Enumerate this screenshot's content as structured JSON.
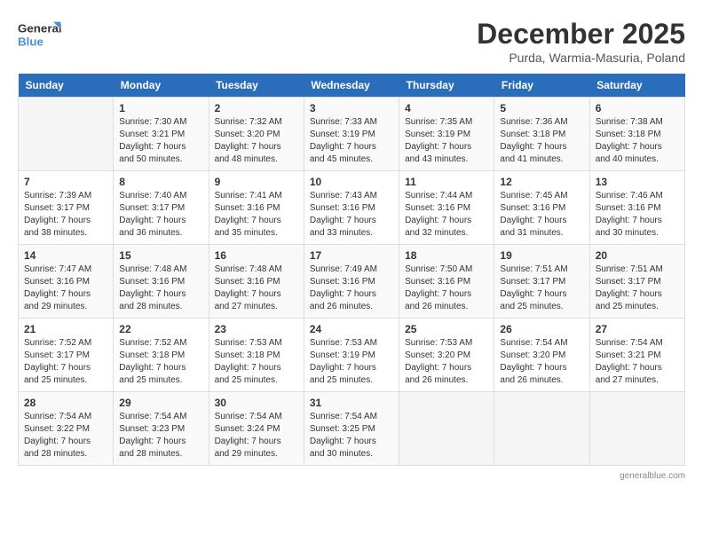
{
  "header": {
    "logo_line1": "General",
    "logo_line2": "Blue",
    "month_title": "December 2025",
    "subtitle": "Purda, Warmia-Masuria, Poland"
  },
  "weekdays": [
    "Sunday",
    "Monday",
    "Tuesday",
    "Wednesday",
    "Thursday",
    "Friday",
    "Saturday"
  ],
  "weeks": [
    [
      {
        "day": "",
        "info": ""
      },
      {
        "day": "1",
        "info": "Sunrise: 7:30 AM\nSunset: 3:21 PM\nDaylight: 7 hours\nand 50 minutes."
      },
      {
        "day": "2",
        "info": "Sunrise: 7:32 AM\nSunset: 3:20 PM\nDaylight: 7 hours\nand 48 minutes."
      },
      {
        "day": "3",
        "info": "Sunrise: 7:33 AM\nSunset: 3:19 PM\nDaylight: 7 hours\nand 45 minutes."
      },
      {
        "day": "4",
        "info": "Sunrise: 7:35 AM\nSunset: 3:19 PM\nDaylight: 7 hours\nand 43 minutes."
      },
      {
        "day": "5",
        "info": "Sunrise: 7:36 AM\nSunset: 3:18 PM\nDaylight: 7 hours\nand 41 minutes."
      },
      {
        "day": "6",
        "info": "Sunrise: 7:38 AM\nSunset: 3:18 PM\nDaylight: 7 hours\nand 40 minutes."
      }
    ],
    [
      {
        "day": "7",
        "info": "Sunrise: 7:39 AM\nSunset: 3:17 PM\nDaylight: 7 hours\nand 38 minutes."
      },
      {
        "day": "8",
        "info": "Sunrise: 7:40 AM\nSunset: 3:17 PM\nDaylight: 7 hours\nand 36 minutes."
      },
      {
        "day": "9",
        "info": "Sunrise: 7:41 AM\nSunset: 3:16 PM\nDaylight: 7 hours\nand 35 minutes."
      },
      {
        "day": "10",
        "info": "Sunrise: 7:43 AM\nSunset: 3:16 PM\nDaylight: 7 hours\nand 33 minutes."
      },
      {
        "day": "11",
        "info": "Sunrise: 7:44 AM\nSunset: 3:16 PM\nDaylight: 7 hours\nand 32 minutes."
      },
      {
        "day": "12",
        "info": "Sunrise: 7:45 AM\nSunset: 3:16 PM\nDaylight: 7 hours\nand 31 minutes."
      },
      {
        "day": "13",
        "info": "Sunrise: 7:46 AM\nSunset: 3:16 PM\nDaylight: 7 hours\nand 30 minutes."
      }
    ],
    [
      {
        "day": "14",
        "info": "Sunrise: 7:47 AM\nSunset: 3:16 PM\nDaylight: 7 hours\nand 29 minutes."
      },
      {
        "day": "15",
        "info": "Sunrise: 7:48 AM\nSunset: 3:16 PM\nDaylight: 7 hours\nand 28 minutes."
      },
      {
        "day": "16",
        "info": "Sunrise: 7:48 AM\nSunset: 3:16 PM\nDaylight: 7 hours\nand 27 minutes."
      },
      {
        "day": "17",
        "info": "Sunrise: 7:49 AM\nSunset: 3:16 PM\nDaylight: 7 hours\nand 26 minutes."
      },
      {
        "day": "18",
        "info": "Sunrise: 7:50 AM\nSunset: 3:16 PM\nDaylight: 7 hours\nand 26 minutes."
      },
      {
        "day": "19",
        "info": "Sunrise: 7:51 AM\nSunset: 3:17 PM\nDaylight: 7 hours\nand 25 minutes."
      },
      {
        "day": "20",
        "info": "Sunrise: 7:51 AM\nSunset: 3:17 PM\nDaylight: 7 hours\nand 25 minutes."
      }
    ],
    [
      {
        "day": "21",
        "info": "Sunrise: 7:52 AM\nSunset: 3:17 PM\nDaylight: 7 hours\nand 25 minutes."
      },
      {
        "day": "22",
        "info": "Sunrise: 7:52 AM\nSunset: 3:18 PM\nDaylight: 7 hours\nand 25 minutes."
      },
      {
        "day": "23",
        "info": "Sunrise: 7:53 AM\nSunset: 3:18 PM\nDaylight: 7 hours\nand 25 minutes."
      },
      {
        "day": "24",
        "info": "Sunrise: 7:53 AM\nSunset: 3:19 PM\nDaylight: 7 hours\nand 25 minutes."
      },
      {
        "day": "25",
        "info": "Sunrise: 7:53 AM\nSunset: 3:20 PM\nDaylight: 7 hours\nand 26 minutes."
      },
      {
        "day": "26",
        "info": "Sunrise: 7:54 AM\nSunset: 3:20 PM\nDaylight: 7 hours\nand 26 minutes."
      },
      {
        "day": "27",
        "info": "Sunrise: 7:54 AM\nSunset: 3:21 PM\nDaylight: 7 hours\nand 27 minutes."
      }
    ],
    [
      {
        "day": "28",
        "info": "Sunrise: 7:54 AM\nSunset: 3:22 PM\nDaylight: 7 hours\nand 28 minutes."
      },
      {
        "day": "29",
        "info": "Sunrise: 7:54 AM\nSunset: 3:23 PM\nDaylight: 7 hours\nand 28 minutes."
      },
      {
        "day": "30",
        "info": "Sunrise: 7:54 AM\nSunset: 3:24 PM\nDaylight: 7 hours\nand 29 minutes."
      },
      {
        "day": "31",
        "info": "Sunrise: 7:54 AM\nSunset: 3:25 PM\nDaylight: 7 hours\nand 30 minutes."
      },
      {
        "day": "",
        "info": ""
      },
      {
        "day": "",
        "info": ""
      },
      {
        "day": "",
        "info": ""
      }
    ]
  ]
}
